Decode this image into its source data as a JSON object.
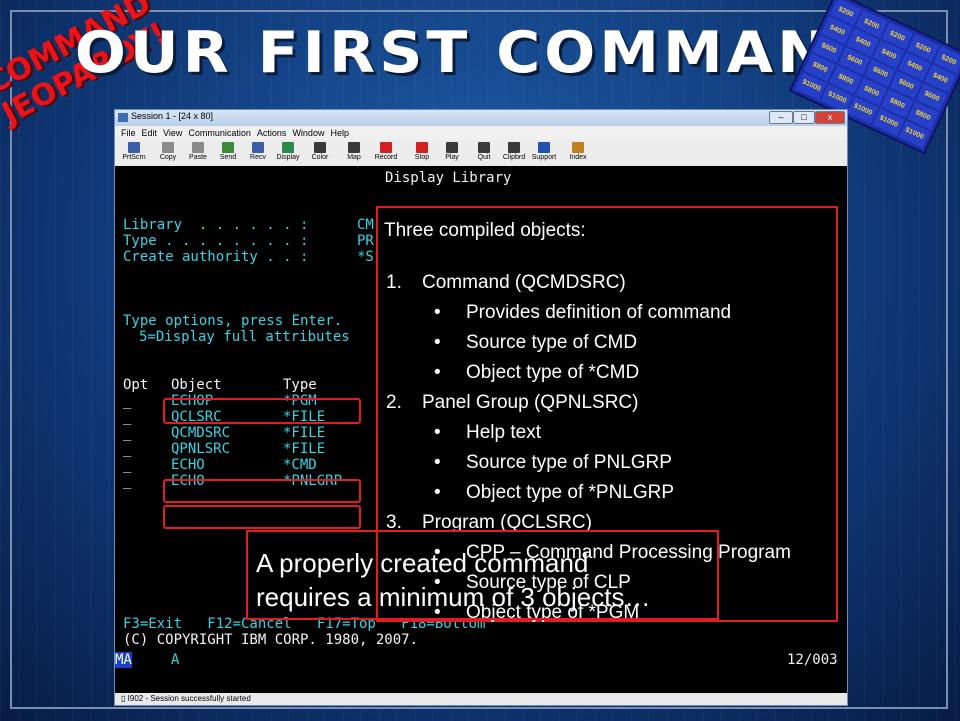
{
  "slide": {
    "title": "OUR FIRST COMMAND",
    "logo_line1": "COMMAND",
    "logo_line2": "JEOPARDY!",
    "board_cells": [
      "$200",
      "$200",
      "$200",
      "$200",
      "$200",
      "$400",
      "$400",
      "$400",
      "$400",
      "$400",
      "$600",
      "$600",
      "$600",
      "$600",
      "$600",
      "$800",
      "$800",
      "$800",
      "$800",
      "$800",
      "$1000",
      "$1000",
      "$1000",
      "$1000",
      "$1000"
    ]
  },
  "window": {
    "title": "Session 1 - [24 x 80]",
    "controls": {
      "minimize": "–",
      "maximize": "□",
      "close": "x"
    },
    "menu": [
      "File",
      "Edit",
      "View",
      "Communication",
      "Actions",
      "Window",
      "Help"
    ],
    "toolbar": [
      {
        "label": "PrtScrn",
        "icon": "print-screen-icon",
        "color": "#3a5fa8"
      },
      {
        "label": "Copy",
        "icon": "copy-icon",
        "color": "#8a8a8a"
      },
      {
        "label": "Paste",
        "icon": "paste-icon",
        "color": "#8a8a8a"
      },
      {
        "label": "Send",
        "icon": "send-icon",
        "color": "#3a8a3a"
      },
      {
        "label": "Recv",
        "icon": "receive-icon",
        "color": "#3a5fa8"
      },
      {
        "label": "Display",
        "icon": "display-icon",
        "color": "#2a8a4a"
      },
      {
        "label": "Color",
        "icon": "color-icon",
        "color": "#3a3a3a"
      },
      {
        "label": "Map",
        "icon": "map-icon",
        "color": "#3a3a3a"
      },
      {
        "label": "Record",
        "icon": "record-icon",
        "color": "#d02020"
      },
      {
        "label": "Stop",
        "icon": "stop-icon",
        "color": "#d02020"
      },
      {
        "label": "Play",
        "icon": "play-icon",
        "color": "#3a3a3a"
      },
      {
        "label": "Quit",
        "icon": "quit-icon",
        "color": "#3a3a3a"
      },
      {
        "label": "Clipbrd",
        "icon": "clipboard-icon",
        "color": "#3a3a3a"
      },
      {
        "label": "Support",
        "icon": "support-icon",
        "color": "#2050b0"
      },
      {
        "label": "Index",
        "icon": "index-icon",
        "color": "#c08020"
      }
    ],
    "status_text": "I902 - Session successfully started"
  },
  "terminal": {
    "screen_title": "Display Library",
    "fields": [
      {
        "label": "Library  . . . . . . :",
        "value": "CM"
      },
      {
        "label": "Type . . . . . . . . :",
        "value": "PR"
      },
      {
        "label": "Create authority . . :",
        "value": "*S"
      }
    ],
    "instructions": "Type options, press Enter.",
    "option5": "5=Display full attributes",
    "columns": {
      "opt": "Opt",
      "object": "Object",
      "type": "Type"
    },
    "rows": [
      {
        "opt": "_",
        "object": "ECHOP",
        "type": "*PGM"
      },
      {
        "opt": "_",
        "object": "QCLSRC",
        "type": "*FILE"
      },
      {
        "opt": "_",
        "object": "QCMDSRC",
        "type": "*FILE"
      },
      {
        "opt": "_",
        "object": "QPNLSRC",
        "type": "*FILE"
      },
      {
        "opt": "_",
        "object": "ECHO",
        "type": "*CMD"
      },
      {
        "opt": "_",
        "object": "ECHO",
        "type": "*PNLGRP"
      }
    ],
    "fkeys": "F3=Exit   F12=Cancel   F17=Top   F18=Bottom",
    "copyright": "(C) COPYRIGHT IBM CORP. 1980, 2007.",
    "oia_left": "MA",
    "oia_mid": "A",
    "oia_right": "12/003"
  },
  "popup": {
    "heading": "Three compiled objects:",
    "items": [
      {
        "num": "1.",
        "title": "Command (QCMDSRC)",
        "bullets": [
          "Provides definition of command",
          "Source type of CMD",
          "Object type of *CMD"
        ]
      },
      {
        "num": "2.",
        "title": "Panel Group (QPNLSRC)",
        "bullets": [
          "Help text",
          "Source type of PNLGRP",
          "Object type of *PNLGRP"
        ]
      },
      {
        "num": "3.",
        "title": "Program (QCLSRC)",
        "bullets": [
          "CPP – Command Processing Program",
          "Source type of CLP",
          "Object type of *PGM"
        ]
      }
    ]
  },
  "callout": {
    "line1": "A properly created command",
    "line2": "requires a minimum of 3 objects…"
  }
}
